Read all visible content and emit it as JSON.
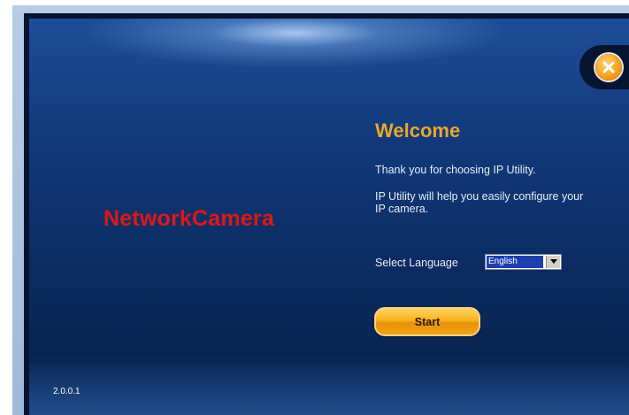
{
  "app": {
    "product_name": "NetworkCamera",
    "version": "2.0.0.1"
  },
  "welcome": {
    "title": "Welcome",
    "line1": "Thank you for choosing IP Utility.",
    "line2": "IP Utility will help you easily configure your IP camera."
  },
  "language": {
    "label": "Select Language",
    "selected": "English"
  },
  "buttons": {
    "start_label": "Start"
  },
  "icons": {
    "close": "close-icon",
    "dropdown": "chevron-down-icon"
  },
  "colors": {
    "accent": "#eaa72b",
    "product_name": "#e01616",
    "background": "#123a7c"
  }
}
